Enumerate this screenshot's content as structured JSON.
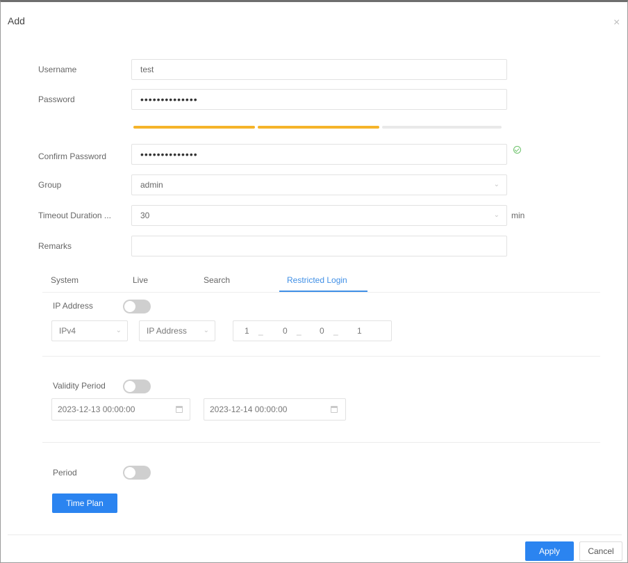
{
  "dialog": {
    "title": "Add",
    "close_symbol": "×"
  },
  "form": {
    "username": {
      "label": "Username",
      "value": "test"
    },
    "password": {
      "label": "Password",
      "value": "••••••••••••••"
    },
    "strength": {
      "segments_filled": 2,
      "segments_total": 3,
      "color": "#f5b42a"
    },
    "confirm_password": {
      "label": "Confirm Password",
      "value": "••••••••••••••"
    },
    "group": {
      "label": "Group",
      "value": "admin"
    },
    "timeout": {
      "label": "Timeout Duration ...",
      "value": "30",
      "unit": "min"
    },
    "remarks": {
      "label": "Remarks",
      "value": ""
    }
  },
  "tabs": [
    {
      "label": "System"
    },
    {
      "label": "Live"
    },
    {
      "label": "Search"
    },
    {
      "label": "Restricted Login",
      "active": true
    }
  ],
  "restricted": {
    "ip_address": {
      "label": "IP Address",
      "enabled": false,
      "ip_version": "IPv4",
      "mode": "IP Address",
      "octets": [
        "1",
        "0",
        "0",
        "1"
      ]
    },
    "validity_period": {
      "label": "Validity Period",
      "enabled": false,
      "start": "2023-12-13 00:00:00",
      "end": "2023-12-14 00:00:00"
    },
    "period": {
      "label": "Period",
      "enabled": false,
      "button_label": "Time Plan"
    }
  },
  "footer": {
    "apply_label": "Apply",
    "cancel_label": "Cancel"
  },
  "colors": {
    "primary": "#2b84f0",
    "tab_active": "#3f8fe6",
    "success": "#6cc26a"
  }
}
